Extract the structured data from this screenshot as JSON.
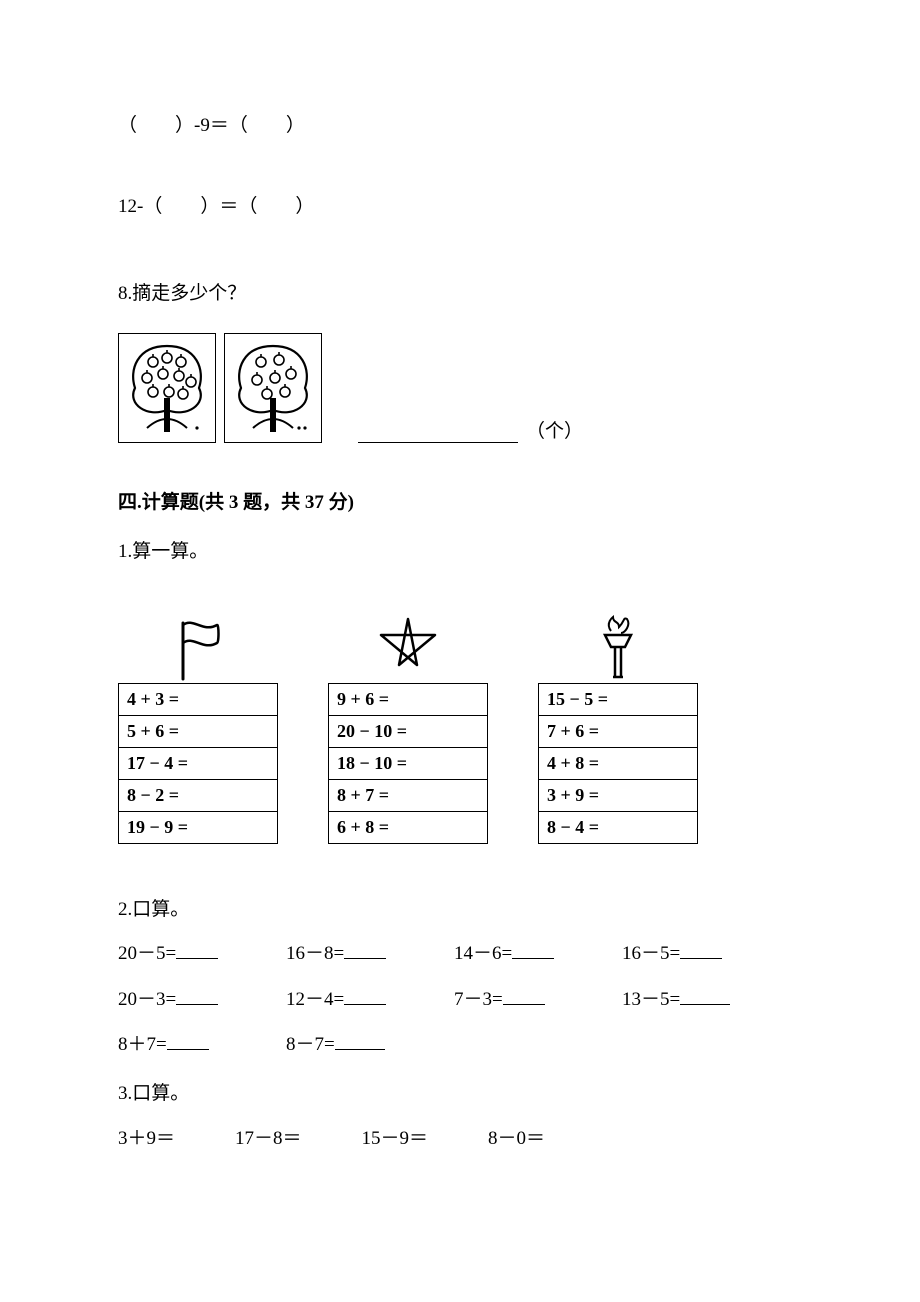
{
  "topLines": {
    "line1": "（　　）-9＝（　　）",
    "line2": "12-（　　）＝（　　）"
  },
  "q8": {
    "label": "8.摘走多少个？",
    "unit": "（个）"
  },
  "section4": {
    "heading": "四.计算题(共 3 题，共 37 分)",
    "q1_label": "1.算一算。",
    "columns": [
      {
        "icon": "flag",
        "rows": [
          "4 + 3 =",
          "5 + 6 =",
          "17 − 4 =",
          "8 − 2 =",
          "19 − 9 ="
        ]
      },
      {
        "icon": "star",
        "rows": [
          "9 + 6 =",
          "20 − 10 =",
          "18 − 10 =",
          "8 + 7 =",
          "6 + 8 ="
        ]
      },
      {
        "icon": "torch",
        "rows": [
          "15 − 5 =",
          "7 + 6 =",
          "4 + 8 =",
          "3 + 9 =",
          "8 − 4 ="
        ]
      }
    ],
    "q2_label": "2.口算。",
    "q2_rows": [
      [
        "20－5=",
        "16－8=",
        "14－6=",
        "16－5="
      ],
      [
        "20－3=",
        "12－4=",
        "7－3=",
        "13－5="
      ],
      [
        "8＋7=",
        "8－7="
      ]
    ],
    "q3_label": "3.口算。",
    "q3_row": [
      "3＋9＝",
      "17－8＝",
      "15－9＝",
      "8－0＝"
    ]
  }
}
